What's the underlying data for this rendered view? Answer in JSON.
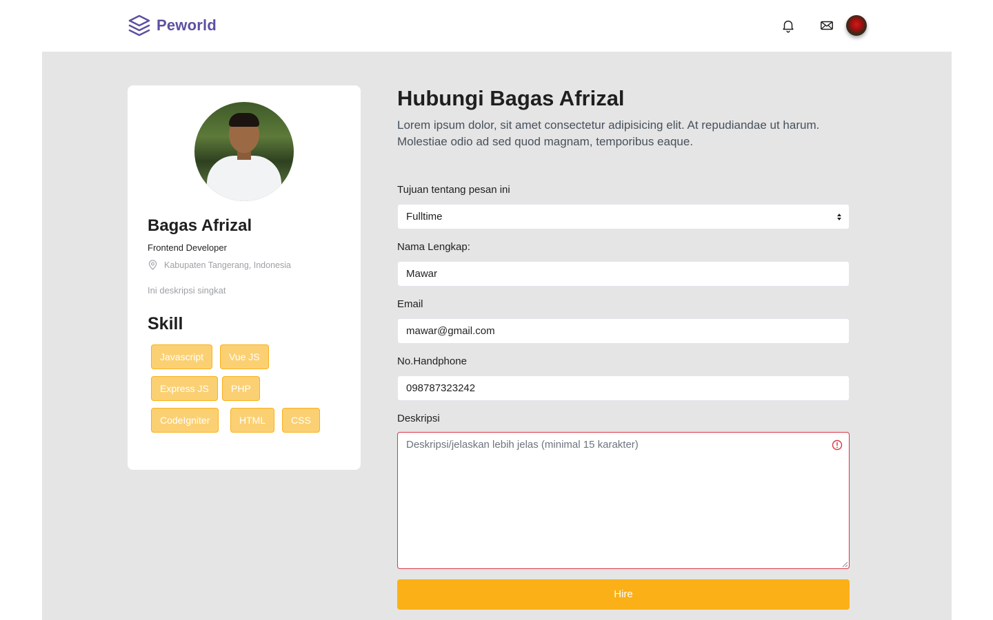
{
  "navbar": {
    "brand": "Peworld",
    "icons": [
      "bell-icon",
      "mail-icon"
    ],
    "avatar": "user-avatar"
  },
  "profile": {
    "name": "Bagas Afrizal",
    "role": "Frontend Developer",
    "location": "Kabupaten Tangerang, Indonesia",
    "description": "Ini deskripsi singkat",
    "skill_title": "Skill",
    "skills": [
      "Javascript",
      "Vue JS",
      "Express JS",
      "PHP",
      "CodeIgniter",
      "HTML",
      "CSS"
    ]
  },
  "form": {
    "title": "Hubungi Bagas Afrizal",
    "subtitle": "Lorem ipsum dolor, sit amet consectetur adipisicing elit. At repudiandae ut harum. Molestiae odio ad sed quod magnam, temporibus eaque.",
    "purpose_label": "Tujuan tentang pesan ini",
    "purpose_value": "Fulltime",
    "name_label": "Nama Lengkap:",
    "name_value": "Mawar",
    "email_label": "Email",
    "email_value": "mawar@gmail.com",
    "phone_label": "No.Handphone",
    "phone_value": "098787323242",
    "desc_label": "Deskripsi",
    "desc_placeholder": "Deskripsi/jelaskan lebih jelas (minimal 15 karakter)",
    "submit_label": "Hire"
  },
  "colors": {
    "brand": "#5e50a1",
    "accent": "#fbb017",
    "chip_bg": "#fbd073",
    "error": "#dc3545",
    "background": "#e5e5e5"
  }
}
